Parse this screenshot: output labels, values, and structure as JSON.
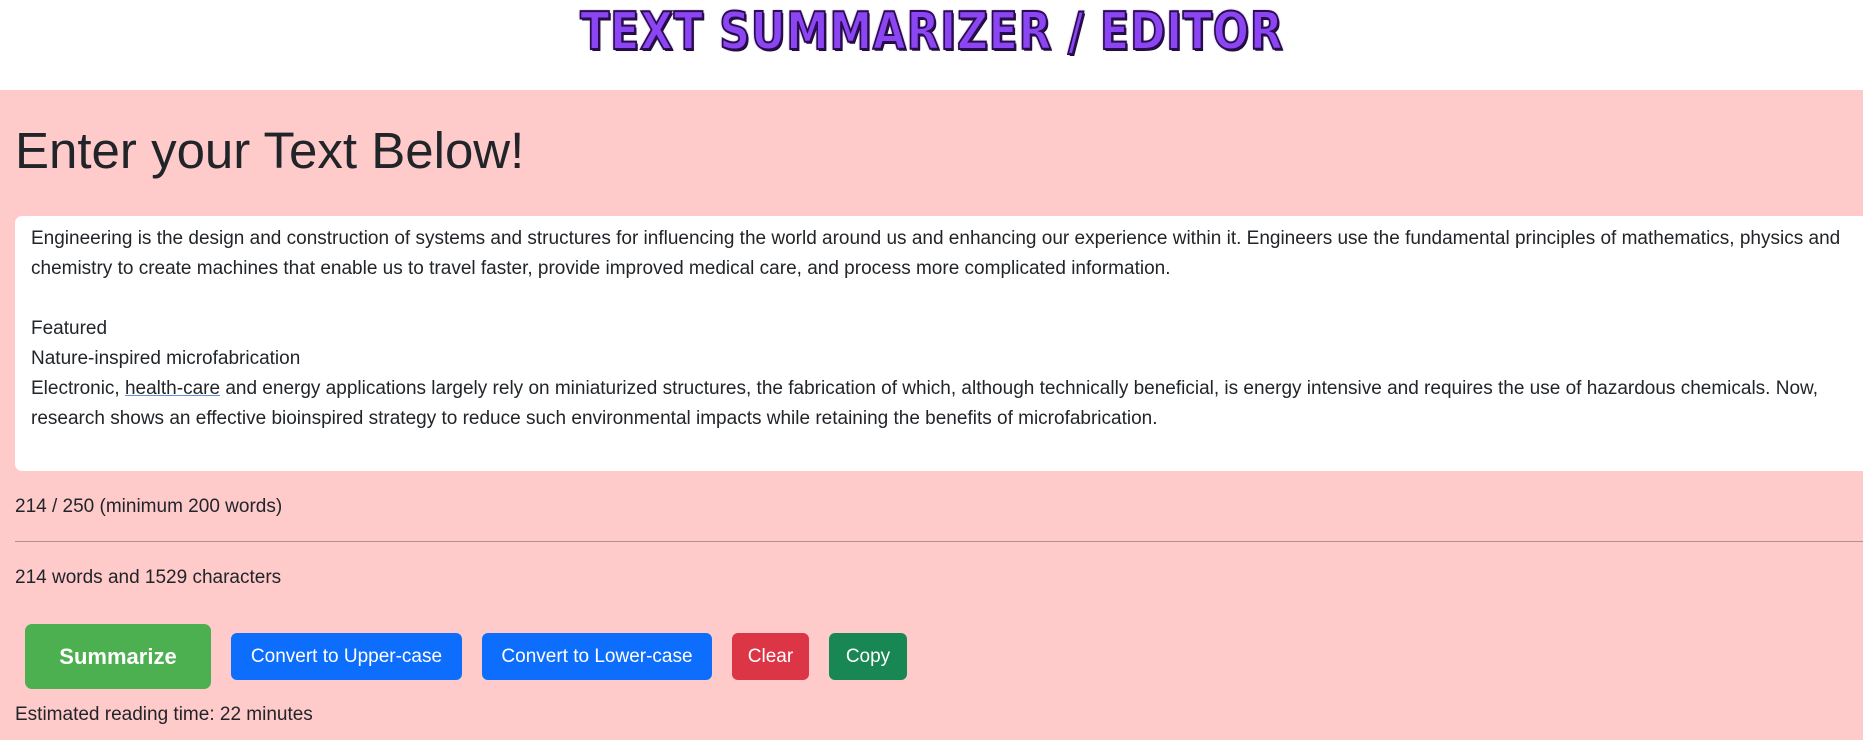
{
  "header": {
    "logo_text": "Text Summarizer / Editor"
  },
  "main": {
    "heading": "Enter your Text Below!",
    "editor": {
      "paragraph1": "Engineering is the design and construction of systems and structures for influencing the world around us and enhancing our experience within it. Engineers use the fundamental principles of mathematics, physics and chemistry to create machines that enable us to travel faster, provide improved medical care, and process more complicated information.",
      "line_featured": "Featured",
      "line_subtitle": "Nature-inspired microfabrication",
      "para2_before": "Electronic, ",
      "para2_link": "health-care",
      "para2_after": " and energy applications largely rely on miniaturized structures, the fabrication of which, although technically beneficial, is energy intensive and requires the use of hazardous chemicals. Now, research shows an effective bioinspired strategy to reduce such environmental impacts while retaining the benefits of microfabrication."
    },
    "progress_text": "214 / 250 (minimum 200 words)",
    "stats_text": "214 words and 1529 characters",
    "buttons": {
      "summarize": "Summarize",
      "upper": "Convert to Upper-case",
      "lower": "Convert to Lower-case",
      "clear": "Clear",
      "copy": "Copy"
    },
    "reading_time": "Estimated reading time: 22 minutes"
  },
  "colors": {
    "page_background": "#ffcaca",
    "summarize_button": "#4caf50",
    "primary_button": "#0d6efd",
    "clear_button": "#dc3545",
    "copy_button": "#198754",
    "logo_fill": "#8b45f2"
  }
}
